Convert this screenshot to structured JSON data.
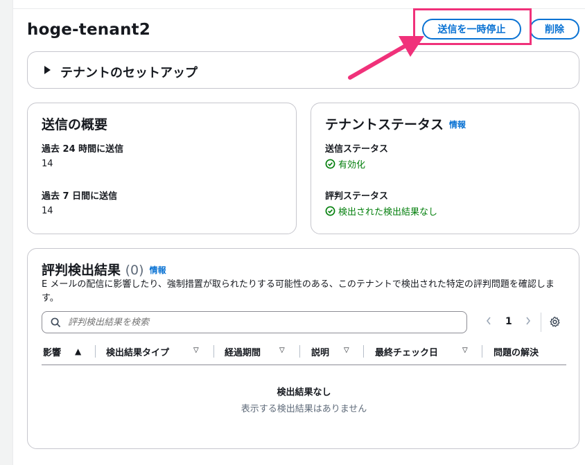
{
  "tenant": {
    "title": "hoge-tenant2"
  },
  "actions": {
    "pause_label": "送信を一時停止",
    "delete_label": "削除"
  },
  "setup": {
    "label": "テナントのセットアップ"
  },
  "summary": {
    "title": "送信の概要",
    "items": [
      {
        "label": "過去 24 時間に送信",
        "value": "14"
      },
      {
        "label": "過去 7 日間に送信",
        "value": "14"
      }
    ]
  },
  "status": {
    "title": "テナントステータス",
    "info_label": "情報",
    "sending_label": "送信ステータス",
    "sending_value": "有効化",
    "reputation_label": "評判ステータス",
    "reputation_value": "検出された検出結果なし"
  },
  "findings": {
    "title": "評判検出結果",
    "count": "(0)",
    "info_label": "情報",
    "description": "E メールの配信に影響したり、強制措置が取られたりする可能性のある、このテナントで検出された特定の評判問題を確認します。",
    "search_placeholder": "評判検出結果を検索",
    "page": "1",
    "columns": [
      "影響",
      "検出結果タイプ",
      "経過期間",
      "説明",
      "最終チェック日",
      "問題の解決"
    ],
    "empty_title": "検出結果なし",
    "empty_subtitle": "表示する検出結果はありません"
  },
  "colors": {
    "accent": "#0972d3",
    "success": "#037f0c",
    "annotation": "#f0317a"
  }
}
